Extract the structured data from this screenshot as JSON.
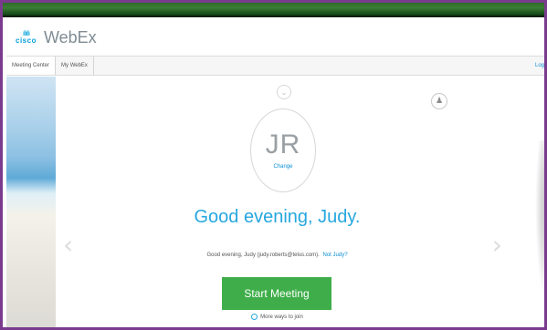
{
  "brand": {
    "logo_text": "cisco",
    "product_name": "WebEx"
  },
  "nav": {
    "tabs": [
      {
        "label": "Meeting Center"
      },
      {
        "label": "My WebEx"
      }
    ],
    "logout_label": "Log"
  },
  "profile": {
    "initials": "JR",
    "change_label": "Change"
  },
  "greeting": "Good evening, Judy.",
  "welcome_line": {
    "text": "Good evening, Judy (judy.roberts@telus.com).",
    "not_you_link": "Not Judy?"
  },
  "start_meeting_label": "Start Meeting",
  "more_ways_label": "More ways to join",
  "colors": {
    "accent_blue": "#26a7df",
    "start_green": "#3fae4a",
    "link_blue": "#0b8ed1",
    "frame_purple": "#7a3b8e"
  },
  "icons": {
    "logo": "cisco-logo-icon",
    "chevron": "chevron-down-icon",
    "contact": "contact-card-icon",
    "prev": "chevron-left-icon",
    "next": "chevron-right-icon",
    "more": "more-options-icon"
  }
}
